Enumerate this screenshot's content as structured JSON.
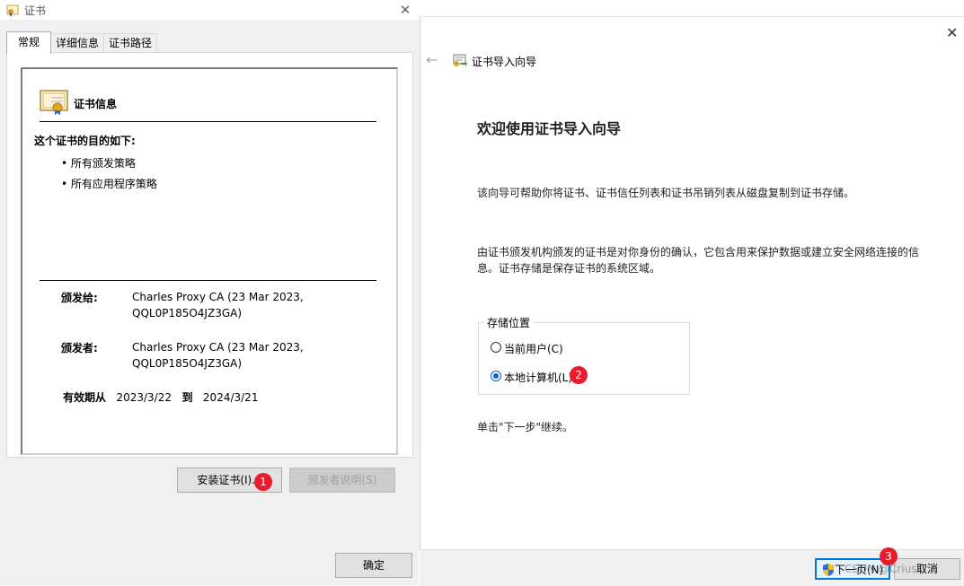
{
  "cert_dialog": {
    "title": "证书",
    "close_glyph": "✕",
    "tabs": [
      "常规",
      "详细信息",
      "证书路径"
    ],
    "info_heading": "证书信息",
    "purpose_heading": "这个证书的目的如下:",
    "purposes": [
      "• 所有颁发策略",
      "• 所有应用程序策略"
    ],
    "issued_to_label": "颁发给:",
    "issued_to_line1": "Charles Proxy CA (23 Mar 2023,",
    "issued_to_line2": "QQL0P185O4JZ3GA)",
    "issued_by_label": "颁发者:",
    "issued_by_line1": "Charles Proxy CA (23 Mar 2023,",
    "issued_by_line2": "QQL0P185O4JZ3GA)",
    "validity_label": "有效期从",
    "valid_from": "2023/3/22",
    "validity_to_label": "到",
    "valid_to": "2024/3/21",
    "install_button": "安装证书(I)...",
    "issuer_statement_button": "颁发者说明(S)",
    "ok_button": "确定"
  },
  "wizard": {
    "close_glyph": "✕",
    "back_glyph": "←",
    "title": "证书导入向导",
    "heading": "欢迎使用证书导入向导",
    "description1": "该向导可帮助你将证书、证书信任列表和证书吊销列表从磁盘复制到证书存储。",
    "description2": "由证书颁发机构颁发的证书是对你身份的确认，它包含用来保护数据或建立安全网络连接的信息。证书存储是保存证书的系统区域。",
    "store_location_label": "存储位置",
    "options": [
      {
        "label": "当前用户(C)",
        "selected": false
      },
      {
        "label": "本地计算机(L)",
        "selected": true
      }
    ],
    "continue_note": "单击\"下一步\"继续。",
    "next_button": "下一页(N)",
    "cancel_button": "取消"
  },
  "markers": [
    "1",
    "2",
    "3"
  ],
  "watermark": "CSDN @Crius"
}
